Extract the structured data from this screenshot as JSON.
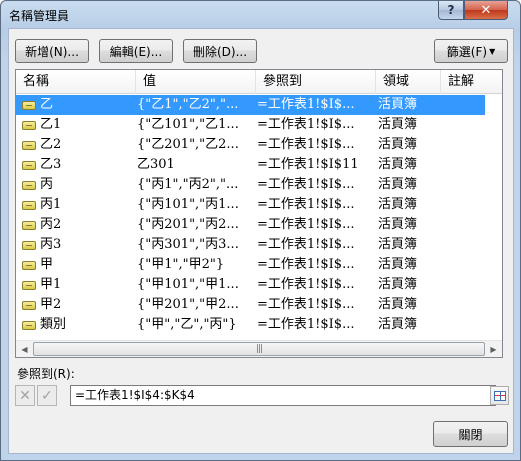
{
  "window": {
    "title": "名稱管理員",
    "help_glyph": "?",
    "close_glyph": "✕"
  },
  "toolbar": {
    "new_label": "新增(N)...",
    "edit_label": "編輯(E)...",
    "delete_label": "刪除(D)...",
    "filter_label": "篩選(F)",
    "filter_caret": "▼"
  },
  "list": {
    "columns": [
      "名稱",
      "值",
      "參照到",
      "領域",
      "註解"
    ],
    "rows": [
      {
        "name": "乙",
        "value": "{\"乙1\",\"乙2\",\"...",
        "ref": "=工作表1!$I$...",
        "scope": "活頁簿",
        "comment": "",
        "selected": true
      },
      {
        "name": "乙1",
        "value": "{\"乙101\",\"乙1...",
        "ref": "=工作表1!$I$...",
        "scope": "活頁簿",
        "comment": "",
        "selected": false
      },
      {
        "name": "乙2",
        "value": "{\"乙201\",\"乙2...",
        "ref": "=工作表1!$I$...",
        "scope": "活頁簿",
        "comment": "",
        "selected": false
      },
      {
        "name": "乙3",
        "value": "乙301",
        "ref": "=工作表1!$I$11",
        "scope": "活頁簿",
        "comment": "",
        "selected": false
      },
      {
        "name": "丙",
        "value": "{\"丙1\",\"丙2\",\"...",
        "ref": "=工作表1!$I$...",
        "scope": "活頁簿",
        "comment": "",
        "selected": false
      },
      {
        "name": "丙1",
        "value": "{\"丙101\",\"丙1...",
        "ref": "=工作表1!$I$...",
        "scope": "活頁簿",
        "comment": "",
        "selected": false
      },
      {
        "name": "丙2",
        "value": "{\"丙201\",\"丙2...",
        "ref": "=工作表1!$I$...",
        "scope": "活頁簿",
        "comment": "",
        "selected": false
      },
      {
        "name": "丙3",
        "value": "{\"丙301\",\"丙3...",
        "ref": "=工作表1!$I$...",
        "scope": "活頁簿",
        "comment": "",
        "selected": false
      },
      {
        "name": "甲",
        "value": "{\"甲1\",\"甲2\"}",
        "ref": "=工作表1!$I$...",
        "scope": "活頁簿",
        "comment": "",
        "selected": false
      },
      {
        "name": "甲1",
        "value": "{\"甲101\",\"甲1...",
        "ref": "=工作表1!$I$...",
        "scope": "活頁簿",
        "comment": "",
        "selected": false
      },
      {
        "name": "甲2",
        "value": "{\"甲201\",\"甲2...",
        "ref": "=工作表1!$I$...",
        "scope": "活頁簿",
        "comment": "",
        "selected": false
      },
      {
        "name": "類別",
        "value": "{\"甲\",\"乙\",\"丙\"}",
        "ref": "=工作表1!$I$...",
        "scope": "活頁簿",
        "comment": "",
        "selected": false
      }
    ],
    "hscroll": {
      "left_arrow": "◀",
      "right_arrow": "▶",
      "grip": "|||"
    }
  },
  "refers_to": {
    "label": "參照到(R):",
    "value": "=工作表1!$I$4:$K$4",
    "cancel_glyph": "✕",
    "confirm_glyph": "✓"
  },
  "footer": {
    "close_label": "關閉"
  },
  "colors": {
    "selection": "#3399ff",
    "dialog_bg": "#f0f0f0",
    "frame": "#bfd3ea"
  }
}
